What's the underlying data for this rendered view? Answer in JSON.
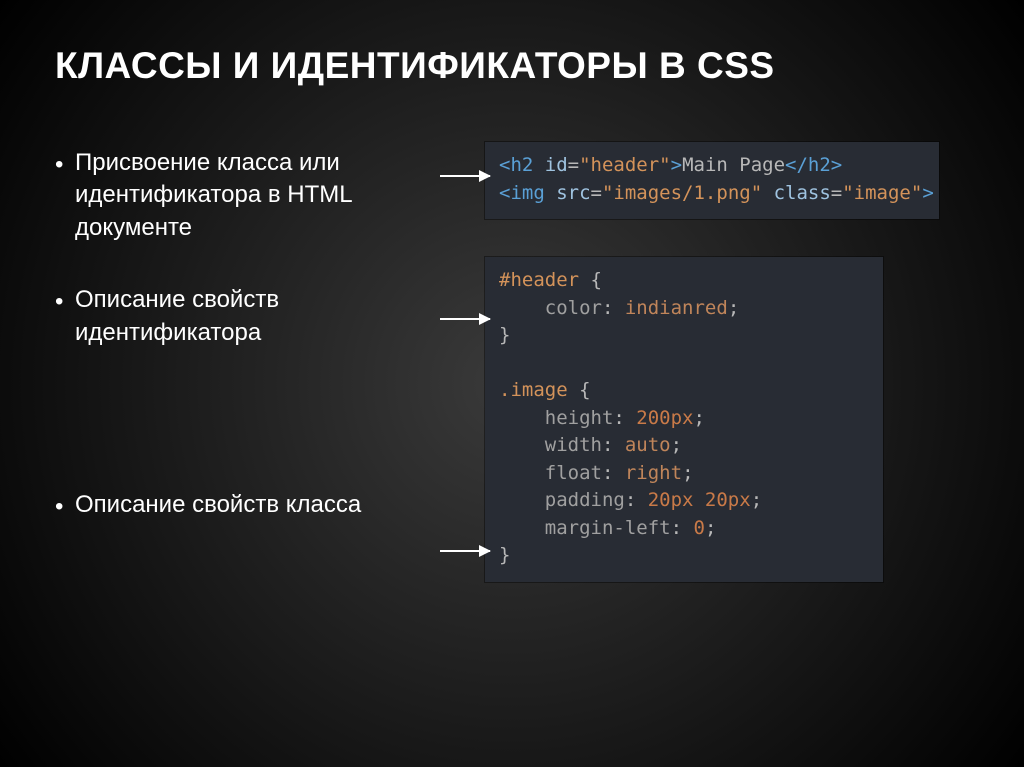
{
  "title": "КЛАССЫ И ИДЕНТИФИКАТОРЫ В CSS",
  "bullets": [
    "Присвоение класса или идентификатора в HTML документе",
    "Описание свойств идентификатора",
    "Описание свойств класса"
  ],
  "code1": {
    "l1_tag_open": "<h2",
    "l1_attr1": " id",
    "l1_eq1": "=",
    "l1_val1": "\"header\"",
    "l1_close1": ">",
    "l1_text": "Main Page",
    "l1_endtag": "</h2>",
    "l2_tag_open": "<img",
    "l2_attr1": " src",
    "l2_eq1": "=",
    "l2_val1": "\"images/1.png\"",
    "l2_attr2": " class",
    "l2_eq2": "=",
    "l2_val2": "\"image\"",
    "l2_close": ">"
  },
  "code2": {
    "r1_sel": "#header",
    "r1_brace": " {",
    "r2_indent": "    ",
    "r2_prop": "color",
    "r2_colon": ": ",
    "r2_val": "indianred",
    "r2_semi": ";",
    "r3_brace": "}",
    "r5_sel": ".image",
    "r5_brace": " {",
    "p1_prop": "height",
    "p1_val": "200px",
    "p2_prop": "width",
    "p2_val": "auto",
    "p3_prop": "float",
    "p3_val": "right",
    "p4_prop": "padding",
    "p4_val": "20px 20px",
    "p5_prop": "margin-left",
    "p5_val": "0",
    "r_end": "}"
  }
}
